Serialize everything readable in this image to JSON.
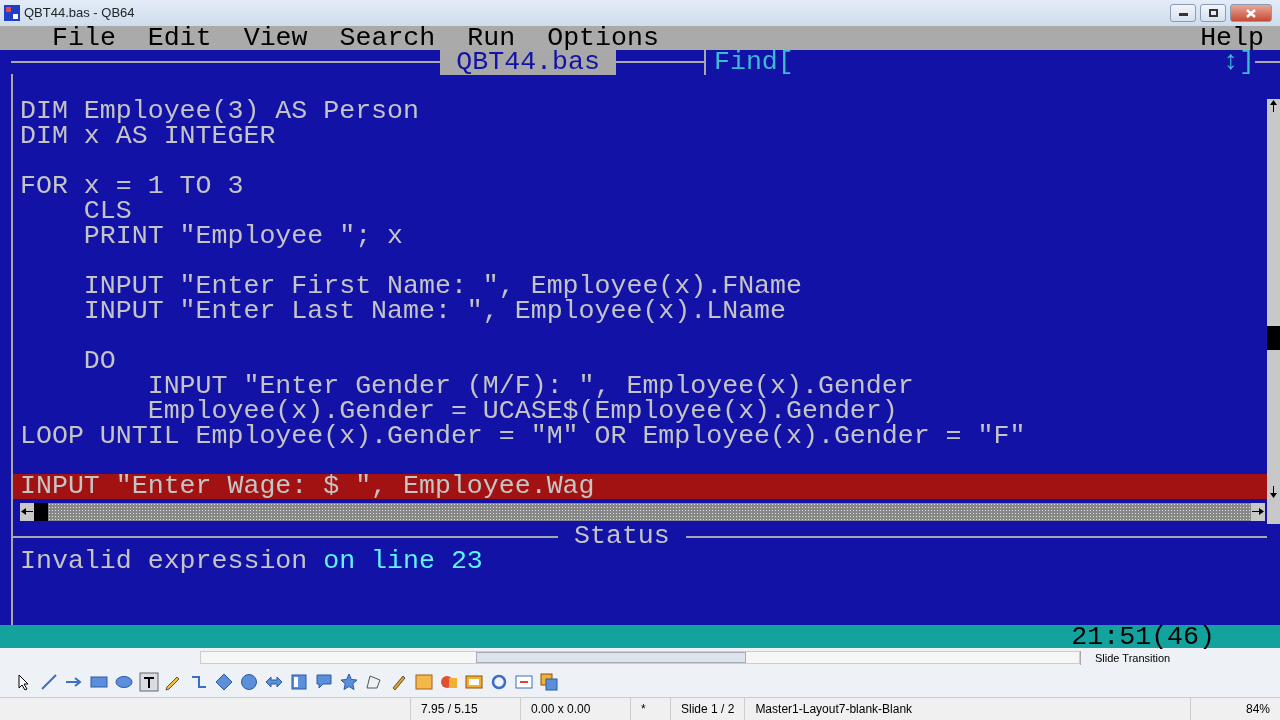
{
  "window": {
    "title": "QBT44.bas - QB64"
  },
  "menu": [
    {
      "label": "File"
    },
    {
      "label": "Edit"
    },
    {
      "label": "View"
    },
    {
      "label": "Search"
    },
    {
      "label": "Run"
    },
    {
      "label": "Options"
    },
    {
      "label": "Help"
    }
  ],
  "editor": {
    "file_title": "QBT44.bas",
    "find_label": "Find[",
    "find_end": "↕]",
    "lines": [
      {
        "kind": "code",
        "text": "DIM Employee(3) AS Person",
        "highlighted": false
      },
      {
        "kind": "code",
        "text": "DIM x AS INTEGER",
        "highlighted": false
      },
      {
        "kind": "blank",
        "highlighted": false
      },
      {
        "kind": "code",
        "text": "FOR x = 1 TO 3",
        "highlighted": false
      },
      {
        "kind": "code",
        "text": "    CLS",
        "highlighted": false
      },
      {
        "kind": "code",
        "text": "    PRINT \"Employee \"; x",
        "highlighted": false
      },
      {
        "kind": "blank",
        "highlighted": false
      },
      {
        "kind": "code",
        "text": "    INPUT \"Enter First Name: \", Employee(x).FName",
        "highlighted": false
      },
      {
        "kind": "code",
        "text": "    INPUT \"Enter Last Name: \", Employee(x).LName",
        "highlighted": false
      },
      {
        "kind": "blank",
        "highlighted": false
      },
      {
        "kind": "code",
        "text": "    DO",
        "highlighted": false
      },
      {
        "kind": "code",
        "text": "        INPUT \"Enter Gender (M/F): \", Employee(x).Gender",
        "highlighted": false
      },
      {
        "kind": "code",
        "text": "        Employee(x).Gender = UCASE$(Employee(x).Gender)",
        "highlighted": false
      },
      {
        "kind": "code",
        "text": "LOOP UNTIL Employee(x).Gender = \"M\" OR Employee(x).Gender = \"F\"",
        "highlighted": false
      },
      {
        "kind": "blank",
        "highlighted": false
      },
      {
        "kind": "code",
        "text": "INPUT \"Enter Wage: $ \", Employee.Wag",
        "highlighted": true
      }
    ]
  },
  "status": {
    "title": "Status",
    "message": [
      {
        "kind": "error",
        "text": "Invalid expression"
      },
      {
        "kind": "location",
        "text": "on line 23"
      }
    ]
  },
  "cursor_position": "21:51(46)",
  "host": {
    "panel_label": "Slide Transition",
    "status_bar": [
      {
        "kind": "position",
        "text": "7.95 / 5.15"
      },
      {
        "kind": "size",
        "text": "0.00 x 0.00"
      },
      {
        "kind": "plain",
        "text": "*"
      },
      {
        "kind": "plain",
        "text": "Slide 1 / 2"
      },
      {
        "kind": "wide",
        "text": "Master1-Layout7-blank-Blank"
      },
      {
        "kind": "zoom",
        "text": "84%"
      }
    ]
  }
}
